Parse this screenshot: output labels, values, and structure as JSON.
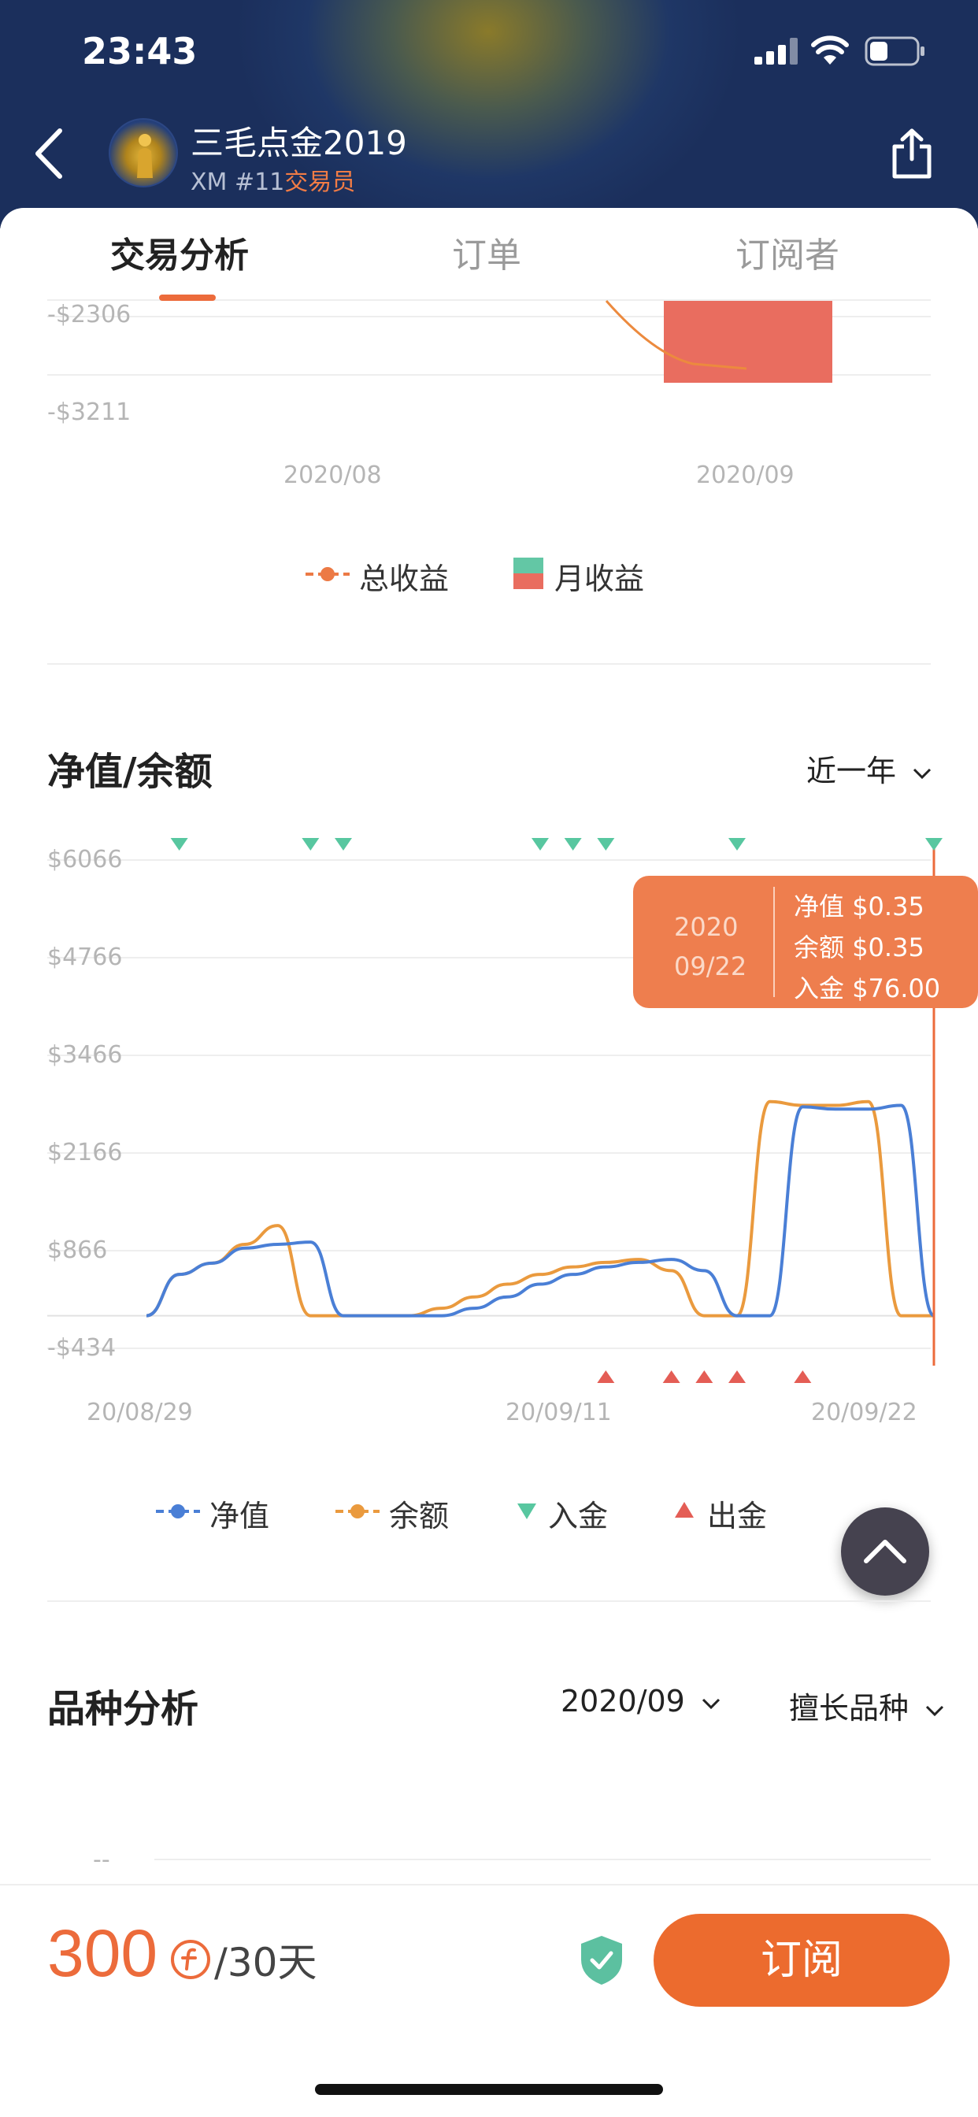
{
  "status": {
    "time": "23:43"
  },
  "header": {
    "trader_name": "三毛点金2019",
    "broker": "XM",
    "rank": "#11",
    "role": "交易员"
  },
  "tabs": [
    "交易分析",
    "订单",
    "订阅者"
  ],
  "active_tab": 0,
  "profit_chart": {
    "y_tick_labels": [
      "-$2306",
      "-$3211"
    ],
    "x_tick_labels": [
      "2020/08",
      "2020/09"
    ],
    "legend": {
      "total": "总收益",
      "monthly": "月收益"
    },
    "colors": {
      "total": "#ec7a45",
      "monthly_up": "#63c7a5",
      "monthly_down": "#e96d5f"
    }
  },
  "equity_section": {
    "title": "净值/余额",
    "range_selector": "近一年"
  },
  "chart_data": {
    "type": "line",
    "y_tick_labels": [
      "$6066",
      "$4766",
      "$3466",
      "$2166",
      "$866",
      "-$434"
    ],
    "ylim": [
      -434,
      6066
    ],
    "x_tick_labels": [
      "20/08/29",
      "20/09/11",
      "20/09/22"
    ],
    "x_dates": [
      "08/29",
      "08/30",
      "08/31",
      "09/01",
      "09/02",
      "09/03",
      "09/04",
      "09/05",
      "09/06",
      "09/07",
      "09/08",
      "09/09",
      "09/10",
      "09/11",
      "09/12",
      "09/13",
      "09/14",
      "09/15",
      "09/16",
      "09/17",
      "09/18",
      "09/19",
      "09/20",
      "09/21",
      "09/22"
    ],
    "series": [
      {
        "name": "净值",
        "color": "#4a7fd6",
        "values": [
          0,
          550,
          700,
          900,
          950,
          980,
          0,
          0,
          0,
          0,
          100,
          250,
          420,
          550,
          650,
          710,
          750,
          600,
          0,
          0,
          2780,
          2750,
          2750,
          2800,
          0
        ]
      },
      {
        "name": "余额",
        "color": "#ea9a3e",
        "values": [
          0,
          550,
          700,
          950,
          1200,
          0,
          0,
          0,
          0,
          100,
          250,
          420,
          550,
          650,
          710,
          750,
          600,
          0,
          0,
          2850,
          2800,
          2800,
          2850,
          0,
          0
        ]
      }
    ],
    "deposit_markers": [
      "08/30",
      "09/03",
      "09/04",
      "09/10",
      "09/11",
      "09/12",
      "09/16",
      "09/22"
    ],
    "withdrawal_markers": [
      "09/12",
      "09/14",
      "09/15",
      "09/16",
      "09/18"
    ],
    "legend": [
      "净值",
      "余额",
      "入金",
      "出金"
    ],
    "marker_colors": {
      "deposit": "#58c7a0",
      "withdrawal": "#e45d55",
      "cursor": "#ec6b3b"
    },
    "tooltip": {
      "date_year": "2020",
      "date_day": "09/22",
      "rows": [
        {
          "label": "净值",
          "value": "$0.35"
        },
        {
          "label": "余额",
          "value": "$0.35"
        },
        {
          "label": "入金",
          "value": "$76.00"
        }
      ]
    }
  },
  "variety_section": {
    "title": "品种分析",
    "month_selector": "2020/09",
    "type_selector": "擅长品种",
    "placeholder_tick": "--"
  },
  "bottom_bar": {
    "price": "300",
    "period": "/30天",
    "subscribe_label": "订阅",
    "accent": "#ec6b2e"
  }
}
